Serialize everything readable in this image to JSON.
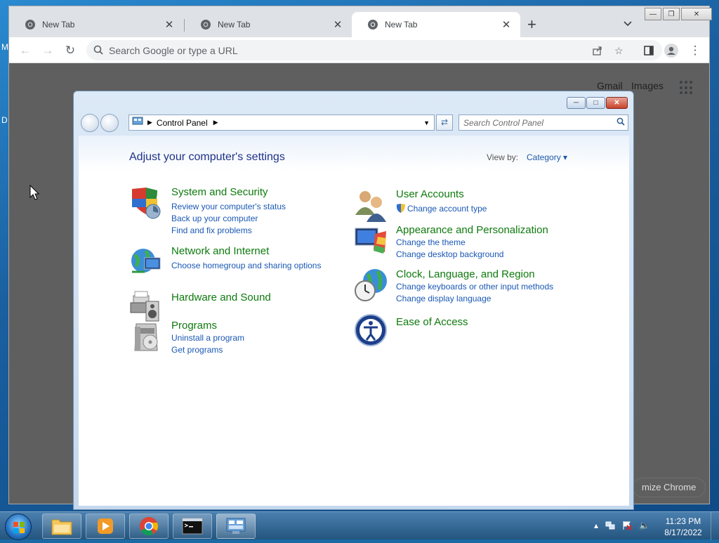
{
  "desktop": {
    "edge_letters": [
      "M",
      "D"
    ]
  },
  "chrome": {
    "tabs": [
      {
        "label": "New Tab",
        "close": "✕"
      },
      {
        "label": "New Tab",
        "close": "✕"
      },
      {
        "label": "New Tab",
        "close": "✕"
      }
    ],
    "new_tab": "+",
    "window_buttons": {
      "minimize": "—",
      "restore": "❐",
      "close": "✕"
    },
    "omnibox": {
      "placeholder": "Search Google or type a URL"
    },
    "ntp": {
      "gmail": "Gmail",
      "images": "Images",
      "customize": "mize Chrome"
    }
  },
  "control_panel": {
    "address": {
      "crumb": "Control Panel"
    },
    "search": {
      "placeholder": "Search Control Panel"
    },
    "heading": "Adjust your computer's settings",
    "view_by": {
      "label": "View by:",
      "value": "Category"
    },
    "left_categories": [
      {
        "title": "System and Security",
        "links": [
          "Review your computer's status",
          "Back up your computer",
          "Find and fix problems"
        ]
      },
      {
        "title": "Network and Internet",
        "links": [
          "Choose homegroup and sharing options"
        ]
      },
      {
        "title": "Hardware and Sound",
        "links": []
      },
      {
        "title": "Programs",
        "links": [
          "Uninstall a program",
          "Get programs"
        ]
      }
    ],
    "right_categories": [
      {
        "title": "User Accounts",
        "links": [
          "Change account type"
        ]
      },
      {
        "title": "Appearance and Personalization",
        "links": [
          "Change the theme",
          "Change desktop background"
        ]
      },
      {
        "title": "Clock, Language, and Region",
        "links": [
          "Change keyboards or other input methods",
          "Change display language"
        ]
      },
      {
        "title": "Ease of Access",
        "links": []
      }
    ]
  },
  "taskbar": {
    "clock_time": "11:23 PM",
    "clock_date": "8/17/2022",
    "apps": [
      "explorer-app",
      "media-player-app",
      "chrome-app",
      "cmd-app",
      "control-panel-app"
    ]
  },
  "colors": {
    "category_green": "#0e7a0d",
    "link_blue": "#1a58b5",
    "heading_blue": "#1e3287"
  }
}
